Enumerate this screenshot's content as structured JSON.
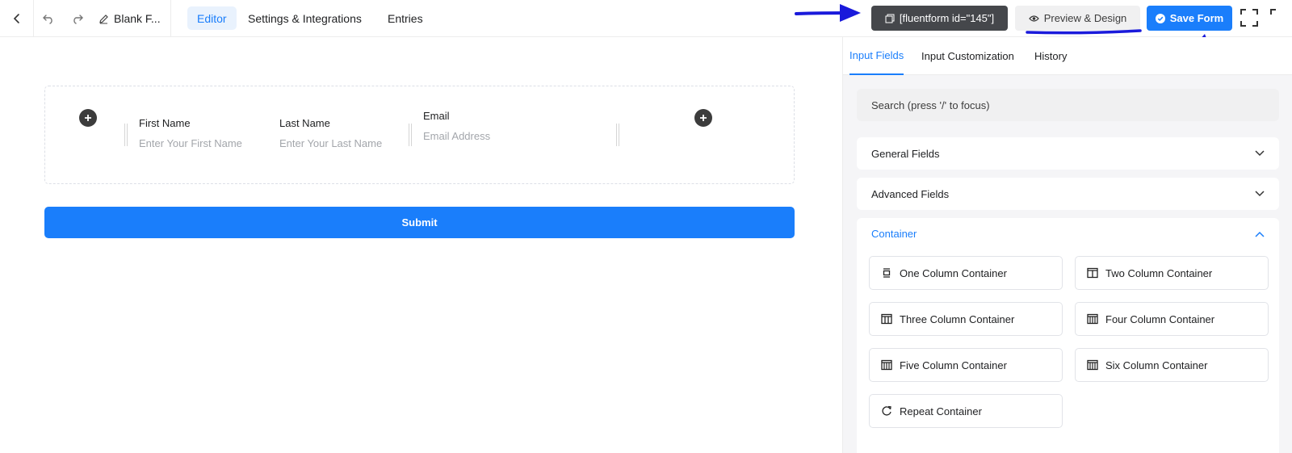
{
  "header": {
    "form_name": "Blank F...",
    "tabs": [
      {
        "label": "Editor",
        "active": true
      },
      {
        "label": "Settings & Integrations",
        "active": false
      },
      {
        "label": "Entries",
        "active": false
      }
    ],
    "shortcode": "[fluentform id=\"145\"]",
    "preview_label": "Preview & Design",
    "save_label": "Save Form",
    "icons": [
      "back-arrow-icon",
      "undo-icon",
      "redo-icon",
      "pencil-icon",
      "copy-icon",
      "eye-icon",
      "check-circle-icon",
      "fullscreen-icon"
    ]
  },
  "form": {
    "fields": [
      {
        "label": "First Name",
        "placeholder": "Enter Your First Name"
      },
      {
        "label": "Last Name",
        "placeholder": "Enter Your Last Name"
      },
      {
        "label": "Email",
        "placeholder": "Email Address"
      }
    ],
    "submit_label": "Submit"
  },
  "panel": {
    "tabs": [
      {
        "label": "Input Fields",
        "active": true
      },
      {
        "label": "Input Customization",
        "active": false
      },
      {
        "label": "History",
        "active": false
      }
    ],
    "search_placeholder": "Search (press '/' to focus)",
    "sections": [
      {
        "label": "General Fields",
        "open": false
      },
      {
        "label": "Advanced Fields",
        "open": false
      },
      {
        "label": "Container",
        "open": true
      }
    ],
    "container_items": [
      {
        "label": "One Column Container",
        "icon": "one-column-icon"
      },
      {
        "label": "Two Column Container",
        "icon": "two-column-icon"
      },
      {
        "label": "Three Column Container",
        "icon": "three-column-icon"
      },
      {
        "label": "Four Column Container",
        "icon": "four-column-icon"
      },
      {
        "label": "Five Column Container",
        "icon": "five-column-icon"
      },
      {
        "label": "Six Column Container",
        "icon": "six-column-icon"
      },
      {
        "label": "Repeat Container",
        "icon": "repeat-icon"
      }
    ]
  },
  "colors": {
    "accent": "#1a7efb",
    "annotation": "#1a1adb",
    "dark_button": "#45474b"
  }
}
